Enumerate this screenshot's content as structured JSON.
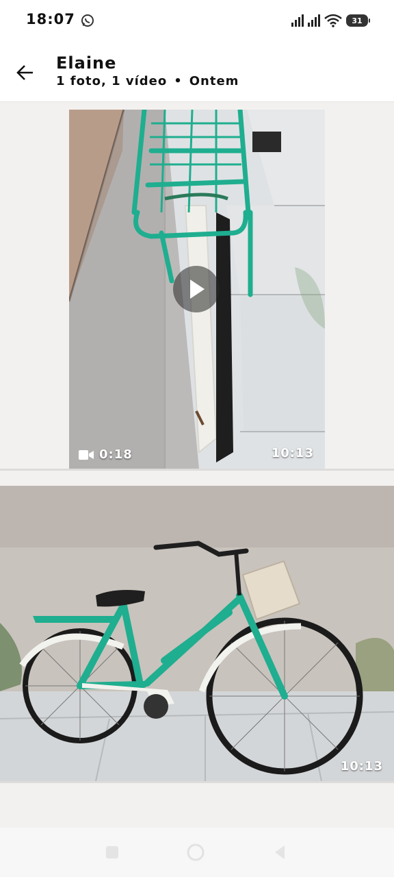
{
  "status_bar": {
    "time": "18:07",
    "battery": "31",
    "icons": [
      "whatsapp-icon",
      "signal-icon",
      "signal-icon",
      "wifi-icon",
      "battery-icon"
    ]
  },
  "header": {
    "contact_name": "Elaine",
    "media_count": "1 foto, 1 vídeo",
    "date": "Ontem"
  },
  "media": [
    {
      "type": "video",
      "duration": "0:18",
      "time": "10:13"
    },
    {
      "type": "photo",
      "time": "10:13"
    }
  ],
  "colors": {
    "bike_teal": "#1fae8f",
    "header_bg": "#ffffff",
    "page_bg": "#f3f1ef"
  }
}
